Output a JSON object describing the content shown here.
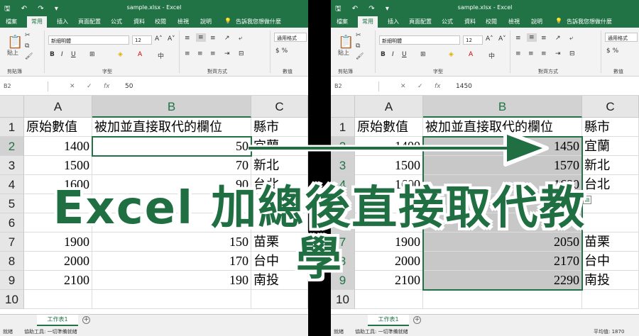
{
  "titlebar": {
    "qat": "🖫 ↶ ↷ ▾",
    "filename": "sample.xlsx",
    "app": "Excel"
  },
  "tabs": [
    "檔案",
    "常用",
    "插入",
    "頁面配置",
    "公式",
    "資料",
    "校閱",
    "檢視",
    "說明"
  ],
  "tell_me": "告訴我您想做什麼",
  "ribbon": {
    "paste_label": "貼上",
    "font_name": "新細明體",
    "font_size": "12",
    "number_format": "通用格式",
    "groups": [
      "剪貼簿",
      "字型",
      "對齊方式",
      "數值"
    ]
  },
  "left": {
    "namebox": "B2",
    "formula_value": "50",
    "columns": [
      "A",
      "B",
      "C"
    ],
    "rows": [
      "1",
      "2",
      "3",
      "4",
      "5",
      "6",
      "7",
      "8",
      "9",
      "10"
    ],
    "cells": [
      [
        "原始數值",
        "被加並直接取代的欄位",
        "縣市"
      ],
      [
        "1400",
        "50",
        "宜蘭"
      ],
      [
        "1500",
        "70",
        "新北"
      ],
      [
        "1600",
        "90",
        "台北"
      ],
      [
        "",
        "",
        ""
      ],
      [
        "",
        "",
        ""
      ],
      [
        "1900",
        "150",
        "苗栗"
      ],
      [
        "2000",
        "170",
        "台中"
      ],
      [
        "2100",
        "190",
        "南投"
      ],
      [
        "",
        "",
        ""
      ]
    ],
    "sheet_tab": "工作表1",
    "status_left": "就緒",
    "status_access": "協助工具: 一切準備就緒"
  },
  "right": {
    "namebox": "B2",
    "formula_value": "1450",
    "columns": [
      "A",
      "B",
      "C"
    ],
    "rows": [
      "1",
      "2",
      "3",
      "4",
      "5",
      "6",
      "7",
      "8",
      "9",
      "10"
    ],
    "cells": [
      [
        "原始數值",
        "被加並直接取代的欄位",
        "縣市"
      ],
      [
        "1400",
        "1450",
        "宜蘭"
      ],
      [
        "1500",
        "1570",
        "新北"
      ],
      [
        "1600",
        "1690",
        "台北"
      ],
      [
        "",
        "",
        ""
      ],
      [
        "",
        "",
        ""
      ],
      [
        "1900",
        "2050",
        "苗栗"
      ],
      [
        "2000",
        "2170",
        "台中"
      ],
      [
        "2100",
        "2290",
        "南投"
      ],
      [
        "",
        "",
        ""
      ]
    ],
    "sheet_tab": "工作表1",
    "status_left": "就緒",
    "status_access": "協助工具: 一切準備就緒",
    "status_avg": "平均值: 1870"
  },
  "banner": "Excel 加總後直接取代教學",
  "colors": {
    "excel_green": "#217346",
    "banner_green": "#1f6f43",
    "selection_shade": "#c8c8c8"
  }
}
